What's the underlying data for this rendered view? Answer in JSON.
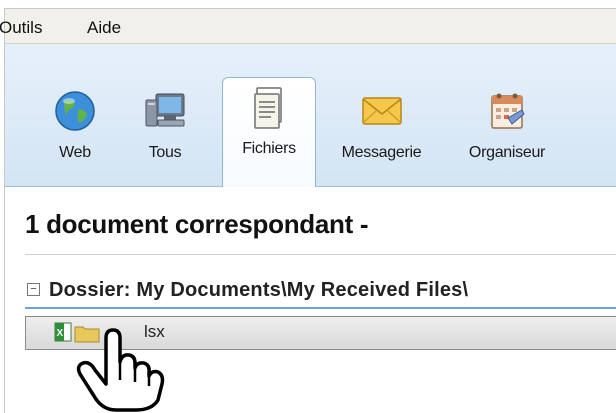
{
  "menu": {
    "items": [
      {
        "label": "Outils"
      },
      {
        "label": "Aide"
      }
    ]
  },
  "tabs": [
    {
      "label": "Web",
      "icon": "globe-icon"
    },
    {
      "label": "Tous",
      "icon": "computer-icon"
    },
    {
      "label": "Fichiers",
      "icon": "document-icon",
      "active": true
    },
    {
      "label": "Messagerie",
      "icon": "envelope-icon"
    },
    {
      "label": "Organiseur",
      "icon": "calendar-icon"
    }
  ],
  "results": {
    "title": "1 document correspondant -"
  },
  "folder": {
    "collapse_symbol": "−",
    "label": "Dossier: My Documents\\My Received Files\\"
  },
  "file": {
    "name": "lsx",
    "icon": "excel-file-icon"
  },
  "cursor": {
    "icon": "hand-pointer-icon"
  },
  "colors": {
    "toolbar_bg": "#dceaf7",
    "active_tab_border": "#8fb6d9",
    "folder_underline": "#66a5e8",
    "file_row_bg": "#e4e4e4"
  }
}
